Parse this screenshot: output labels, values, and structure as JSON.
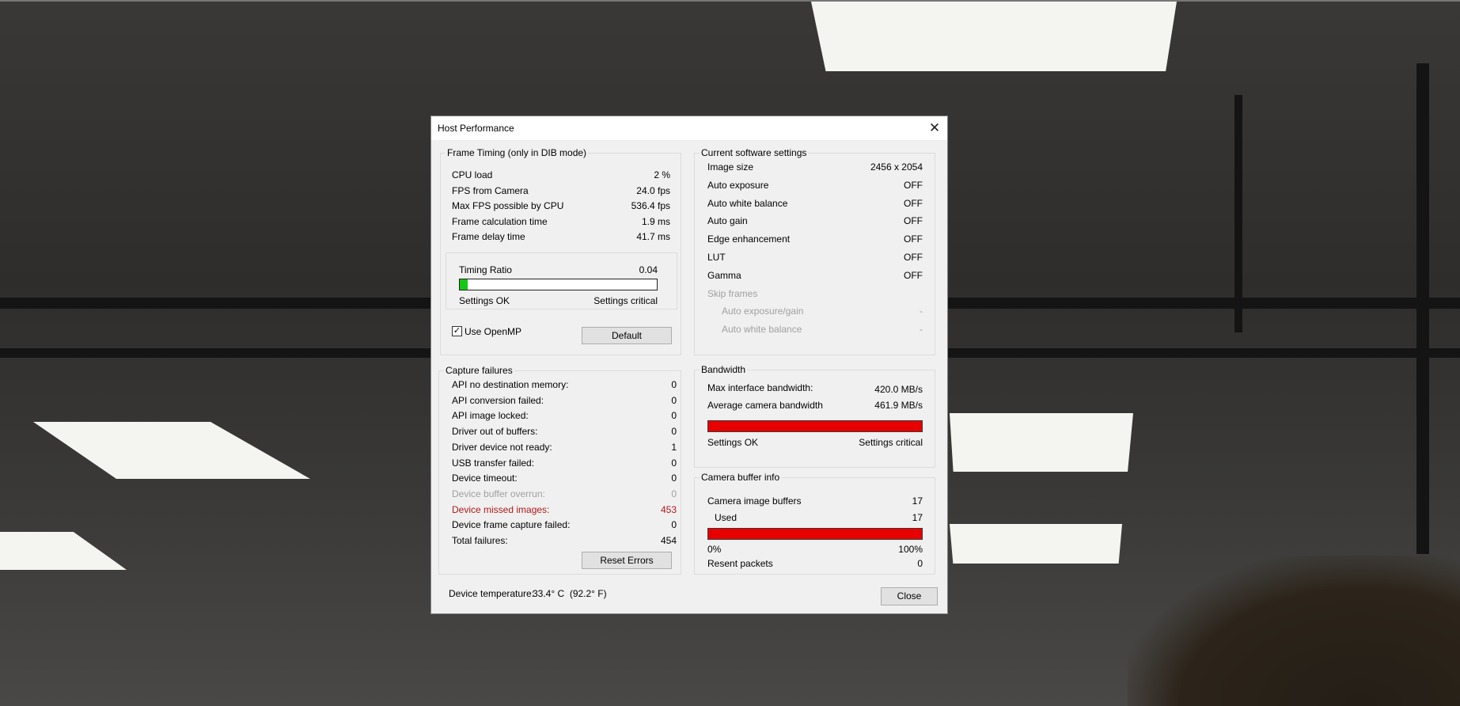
{
  "dialog": {
    "title": "Host Performance",
    "close_label": "Close",
    "default_label": "Default",
    "reset_errors_label": "Reset Errors",
    "device_temperature_label": "Device temperature:",
    "device_temperature_value": "33.4° C  (92.2° F)"
  },
  "frame_timing": {
    "title": "Frame Timing (only in DIB mode)",
    "rows": [
      {
        "label": "CPU load",
        "value": "2 %"
      },
      {
        "label": "FPS from Camera",
        "value": "24.0 fps"
      },
      {
        "label": "Max FPS possible by CPU",
        "value": "536.4 fps"
      },
      {
        "label": "Frame calculation time",
        "value": "1.9 ms"
      },
      {
        "label": "Frame delay time",
        "value": "41.7 ms"
      }
    ],
    "timing_ratio_label": "Timing Ratio",
    "timing_ratio_value": "0.04",
    "timing_ratio_fraction": 0.04,
    "bar_left_label": "Settings OK",
    "bar_right_label": "Settings critical",
    "use_openmp_label": "Use OpenMP",
    "use_openmp_checked": true,
    "checkmark": "✓"
  },
  "software_settings": {
    "title": "Current software settings",
    "rows": [
      {
        "label": "Image size",
        "value": "2456 x 2054"
      },
      {
        "label": "Auto exposure",
        "value": "OFF"
      },
      {
        "label": "Auto white balance",
        "value": "OFF"
      },
      {
        "label": "Auto gain",
        "value": "OFF"
      },
      {
        "label": "Edge enhancement",
        "value": "OFF"
      },
      {
        "label": "LUT",
        "value": "OFF"
      },
      {
        "label": "Gamma",
        "value": "OFF"
      }
    ],
    "skip_frames_label": "Skip frames",
    "skip_rows": [
      {
        "label": "Auto exposure/gain",
        "value": "-"
      },
      {
        "label": "Auto white balance",
        "value": "-"
      }
    ]
  },
  "capture_failures": {
    "title": "Capture failures",
    "rows": [
      {
        "label": "API no destination memory:",
        "value": "0"
      },
      {
        "label": "API conversion failed:",
        "value": "0"
      },
      {
        "label": "API image locked:",
        "value": "0"
      },
      {
        "label": "Driver out of buffers:",
        "value": "0"
      },
      {
        "label": "Driver device not ready:",
        "value": "1"
      },
      {
        "label": "USB transfer failed:",
        "value": "0"
      },
      {
        "label": "Device timeout:",
        "value": "0"
      },
      {
        "label": "Device buffer overrun:",
        "value": "0"
      },
      {
        "label": "Device missed images:",
        "value": "453"
      },
      {
        "label": "Device frame capture failed:",
        "value": "0"
      },
      {
        "label": "Total failures:",
        "value": "454"
      }
    ]
  },
  "bandwidth": {
    "title": "Bandwidth",
    "max_label": "Max interface bandwidth:",
    "max_value": "420.0 MB/s",
    "avg_label": "Average camera bandwidth",
    "avg_value": "461.9 MB/s",
    "bar_fraction": 1.0,
    "bar_left_label": "Settings OK",
    "bar_right_label": "Settings critical"
  },
  "buffer_info": {
    "title": "Camera buffer info",
    "buffers_label": "Camera image buffers",
    "buffers_value": "17",
    "used_label": "Used",
    "used_value": "17",
    "bar_fraction": 1.0,
    "min_label": "0%",
    "max_label": "100%",
    "resent_label": "Resent packets",
    "resent_value": "0"
  },
  "colors": {
    "ok_green": "#16c816",
    "critical_red": "#e80000",
    "error_text": "#b01818",
    "disabled_text": "#a0a0a0"
  }
}
